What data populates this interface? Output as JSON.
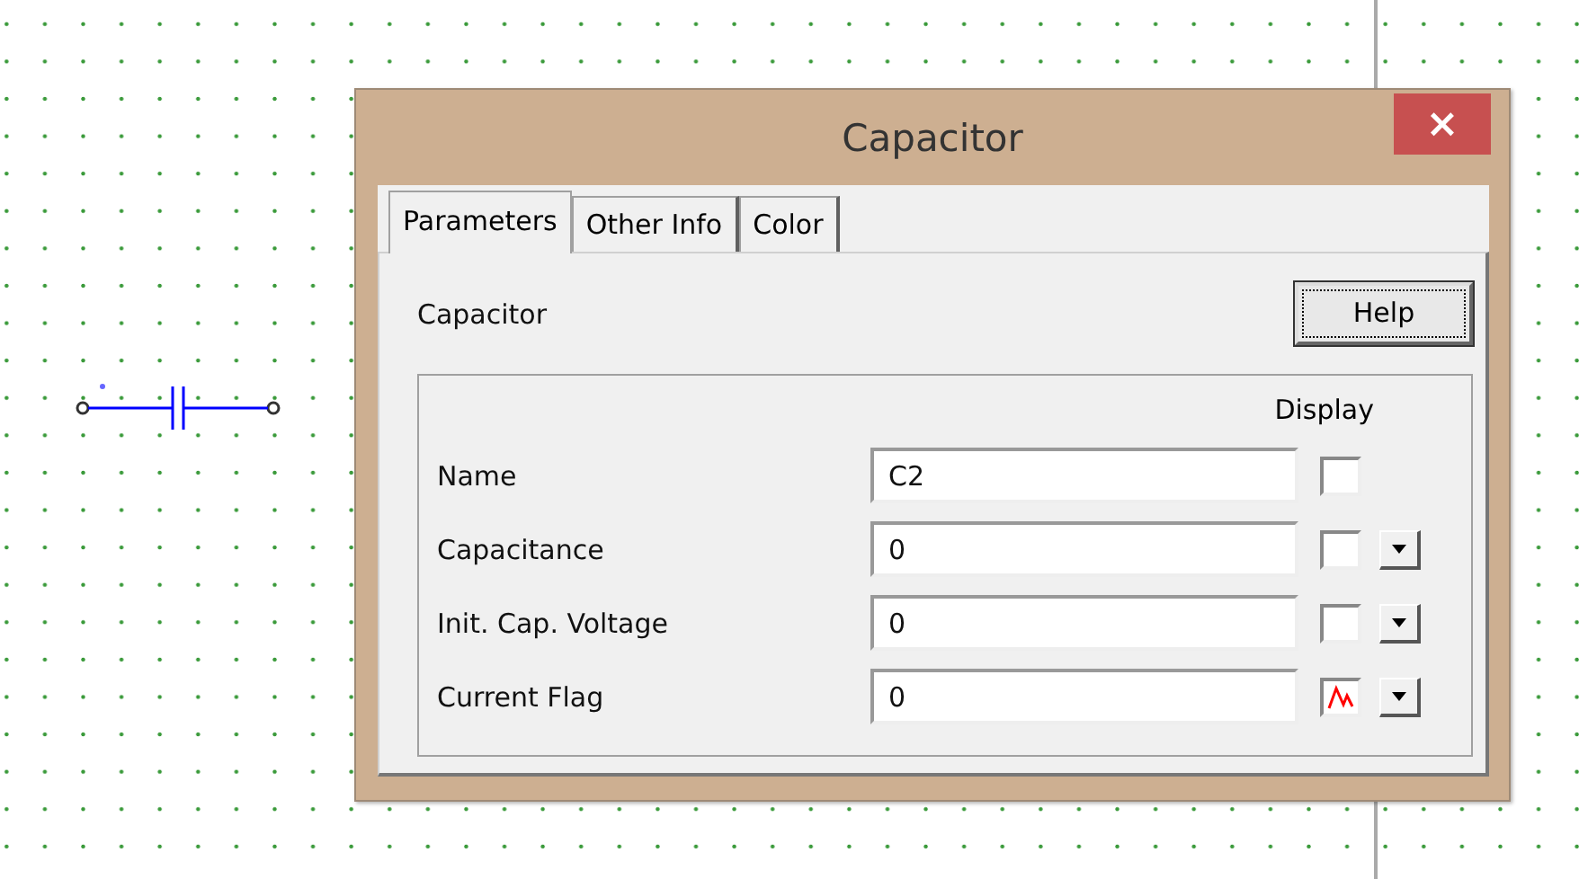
{
  "dialog": {
    "title": "Capacitor",
    "close_glyph": "×"
  },
  "tabs": [
    {
      "label": "Parameters",
      "selected": true
    },
    {
      "label": "Other Info",
      "selected": false
    },
    {
      "label": "Color",
      "selected": false
    }
  ],
  "panel": {
    "heading": "Capacitor",
    "help_button": "Help",
    "display_header": "Display"
  },
  "fields": [
    {
      "label": "Name",
      "value": "C2",
      "display_checked": false,
      "has_dropdown": false
    },
    {
      "label": "Capacitance",
      "value": "0",
      "display_checked": false,
      "has_dropdown": true
    },
    {
      "label": "Init. Cap. Voltage",
      "value": "0",
      "display_checked": false,
      "has_dropdown": true
    },
    {
      "label": "Current Flag",
      "value": "0",
      "display_checked": true,
      "has_dropdown": true
    }
  ]
}
